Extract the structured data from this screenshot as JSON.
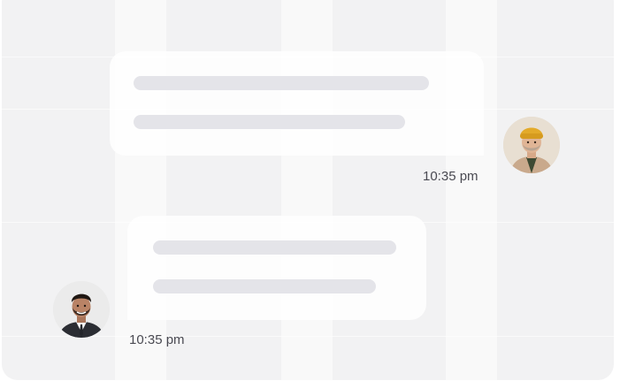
{
  "conversation": {
    "messages": [
      {
        "direction": "outgoing",
        "time": "10:35 pm",
        "avatar": {
          "description_icon": "person-yellow-beanie-avatar"
        }
      },
      {
        "direction": "incoming",
        "time": "10:35 pm",
        "avatar": {
          "description_icon": "person-dark-suit-avatar"
        }
      }
    ]
  },
  "colors": {
    "background": "#f2f2f3",
    "bubble": "#ffffff",
    "placeholder_line": "#e4e4e9",
    "timestamp": "#4a4a52"
  }
}
